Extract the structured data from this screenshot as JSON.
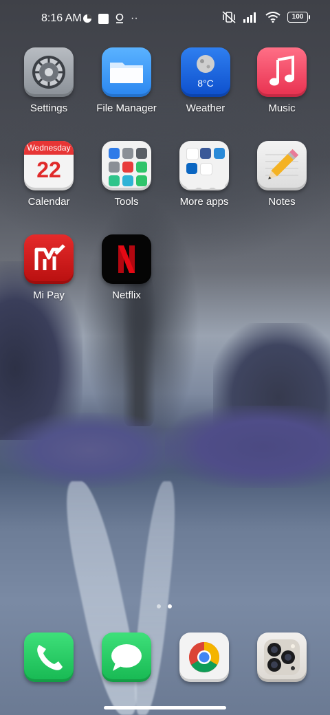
{
  "status_bar": {
    "time": "8:16 AM",
    "overflow": "··",
    "battery": "100"
  },
  "apps": [
    {
      "label": "Settings",
      "icon": "settings-gear-icon"
    },
    {
      "label": "File Manager",
      "icon": "folder-icon"
    },
    {
      "label": "Weather",
      "icon": "moon-icon",
      "temperature": "8°C"
    },
    {
      "label": "Music",
      "icon": "music-note-icon"
    },
    {
      "label": "Calendar",
      "icon": "calendar-icon",
      "weekday": "Wednesday",
      "day": "22"
    },
    {
      "label": "Tools",
      "icon": "tools-folder-icon"
    },
    {
      "label": "More apps",
      "icon": "apps-folder-icon"
    },
    {
      "label": "Notes",
      "icon": "pencil-icon"
    },
    {
      "label": "Mi Pay",
      "icon": "mi-pay-logo-icon"
    },
    {
      "label": "Netflix",
      "icon": "netflix-logo-icon"
    }
  ],
  "dock": [
    {
      "icon": "phone-icon"
    },
    {
      "icon": "messages-icon"
    },
    {
      "icon": "chrome-icon"
    },
    {
      "icon": "camera-icon"
    }
  ],
  "colors": {
    "weather_blue": "#0d4fcc",
    "music_red": "#e8304f",
    "dock_green": "#17b852",
    "netflix_red": "#e50914"
  }
}
